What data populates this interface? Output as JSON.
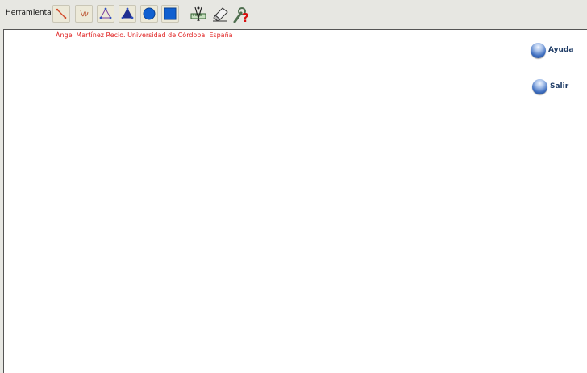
{
  "toolbar": {
    "label": "Herramientas",
    "tools": [
      {
        "name": "segment",
        "icon": "segment-icon"
      },
      {
        "name": "curve",
        "icon": "freehand-curve-icon"
      },
      {
        "name": "polygon",
        "icon": "polygon-icon"
      },
      {
        "name": "filled-polygon",
        "icon": "filled-triangle-icon"
      },
      {
        "name": "circle",
        "icon": "circle-icon"
      },
      {
        "name": "square",
        "icon": "square-icon"
      },
      {
        "name": "compass-ruler",
        "icon": "compass-ruler-icon"
      },
      {
        "name": "eraser",
        "icon": "eraser-icon"
      },
      {
        "name": "help-tool",
        "icon": "wrench-question-icon"
      }
    ]
  },
  "canvas": {
    "credit": "Ángel Martínez Recio. Universidad de Córdoba. España"
  },
  "links": {
    "help": "Ayuda",
    "exit": "Salir"
  },
  "colors": {
    "credit": "#e02020",
    "link_text": "#1f3c66",
    "shape_blue": "#1060d0"
  }
}
